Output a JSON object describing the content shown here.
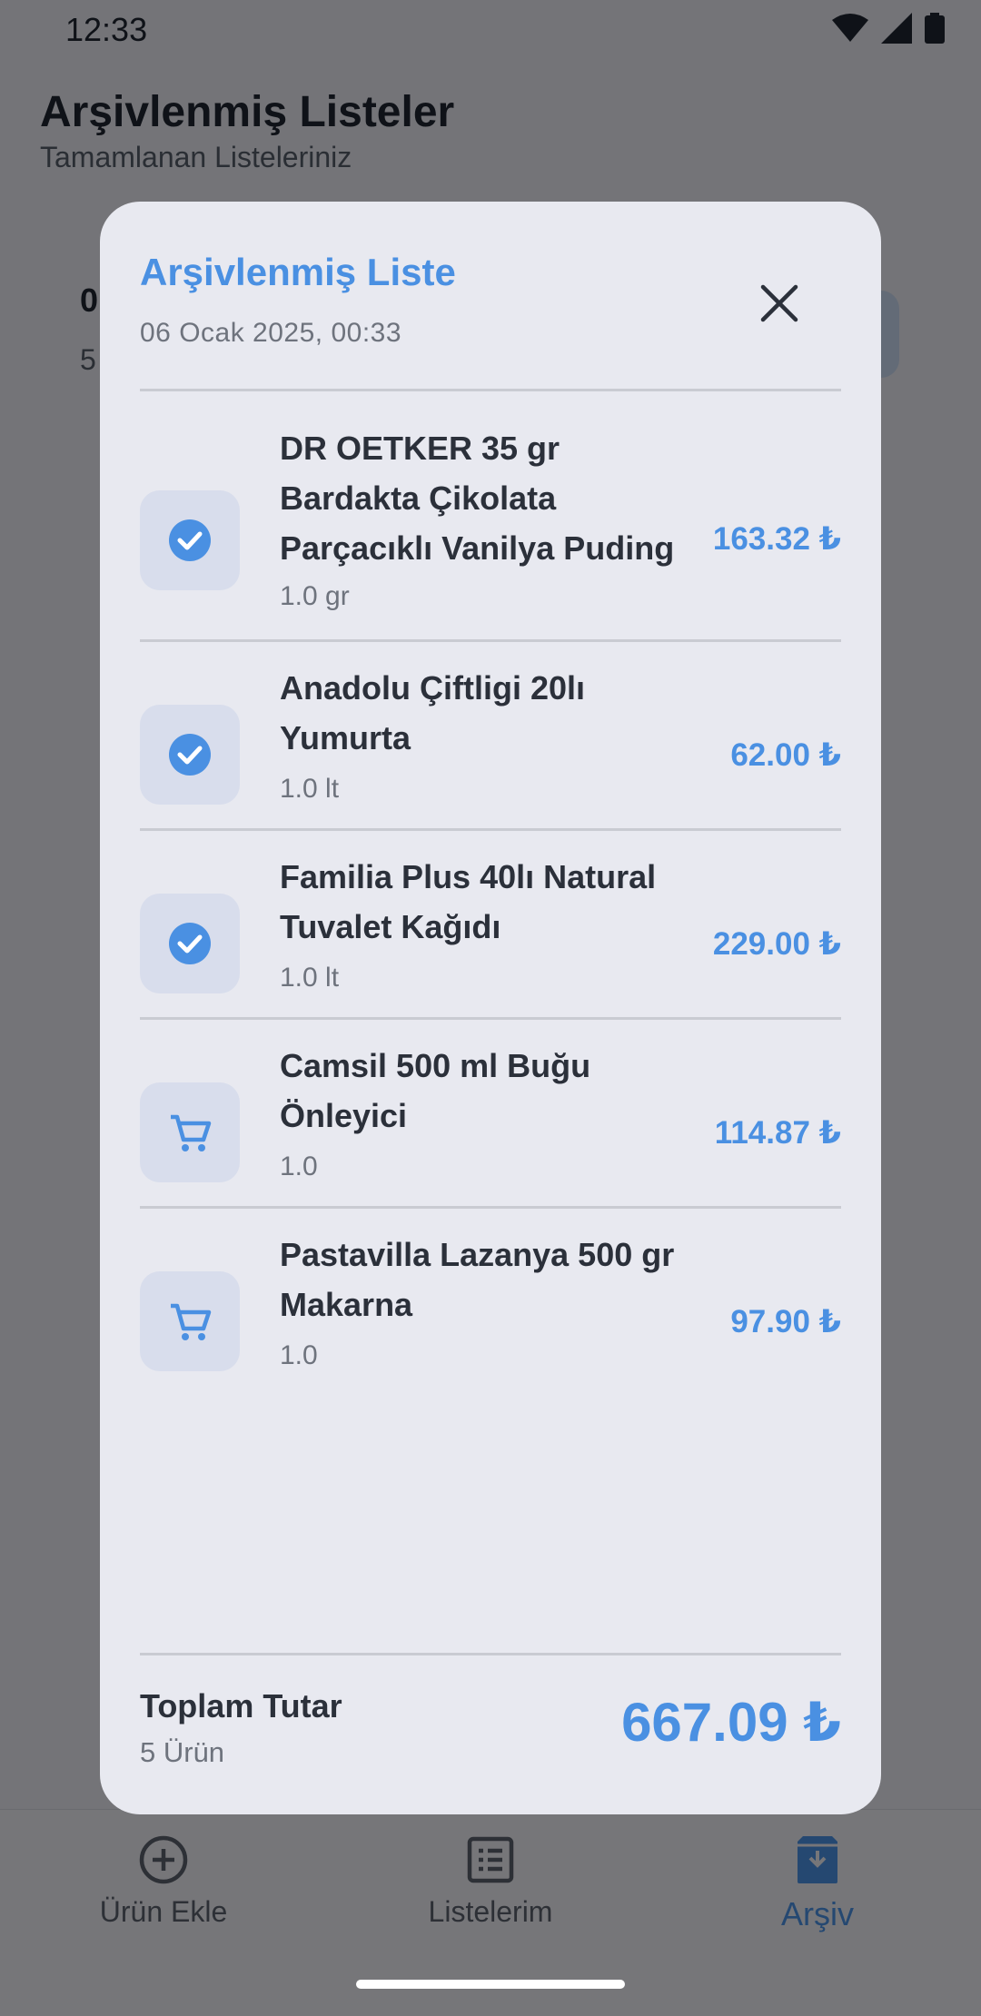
{
  "status_bar": {
    "time": "12:33"
  },
  "screen": {
    "title": "Arşivlenmiş Listeler",
    "subtitle": "Tamamlanan Listeleriniz",
    "card_partial_a": "0",
    "card_partial_b": "5"
  },
  "bottom_nav": {
    "items": [
      {
        "label": "Ürün Ekle",
        "icon": "add-circle-icon",
        "active": false
      },
      {
        "label": "Listelerim",
        "icon": "list-icon",
        "active": false
      },
      {
        "label": "Arşiv",
        "icon": "archive-icon",
        "active": true
      }
    ]
  },
  "dialog": {
    "title": "Arşivlenmiş Liste",
    "date": "06 Ocak 2025, 00:33",
    "close_icon": "close-icon",
    "items": [
      {
        "name": "DR OETKER 35 gr Bardakta Çikolata Parçacıklı Vanilya Puding",
        "quantity": "1.0 gr",
        "price": "163.32 ₺",
        "status": "checked"
      },
      {
        "name": "Anadolu Çiftligi 20lı Yumurta",
        "quantity": "1.0 lt",
        "price": "62.00 ₺",
        "status": "checked"
      },
      {
        "name": "Familia Plus 40lı Natural Tuvalet Kağıdı",
        "quantity": "1.0 lt",
        "price": "229.00 ₺",
        "status": "checked"
      },
      {
        "name": "Camsil 500 ml Buğu Önleyici",
        "quantity": "1.0",
        "price": "114.87 ₺",
        "status": "in-cart"
      },
      {
        "name": "Pastavilla Lazanya 500 gr Makarna",
        "quantity": "1.0",
        "price": "97.90 ₺",
        "status": "in-cart"
      }
    ],
    "footer": {
      "total_label": "Toplam Tutar",
      "item_count": "5 Ürün",
      "total": "667.09 ₺"
    }
  },
  "colors": {
    "accent": "#4A90E2",
    "surface": "#E8E9F0",
    "icon_box": "#D8DDEC"
  }
}
